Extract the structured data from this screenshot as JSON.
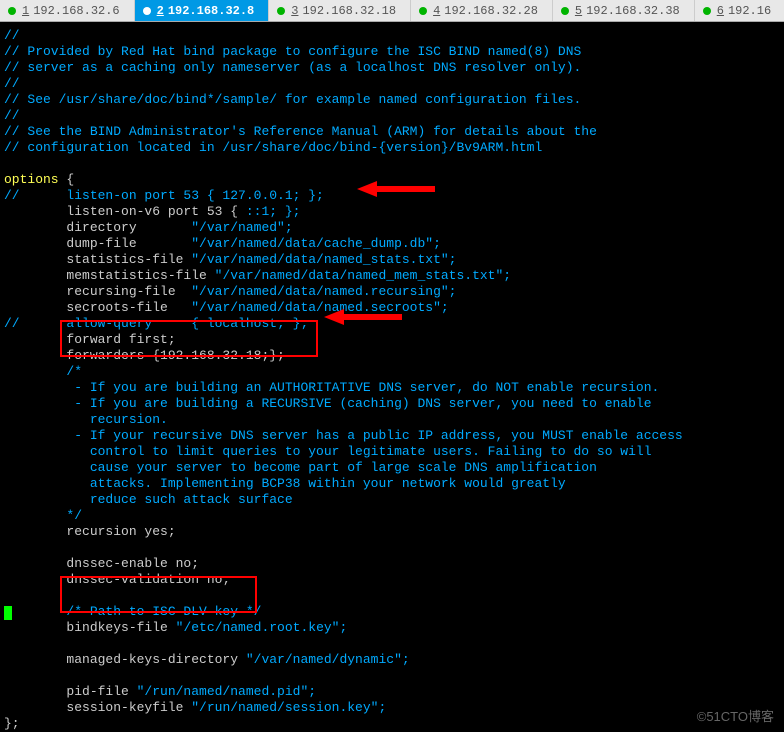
{
  "tabs": [
    {
      "num": "1",
      "ip": "192.168.32.6",
      "active": false
    },
    {
      "num": "2",
      "ip": "192.168.32.8",
      "active": true
    },
    {
      "num": "3",
      "ip": "192.168.32.18",
      "active": false
    },
    {
      "num": "4",
      "ip": "192.168.32.28",
      "active": false
    },
    {
      "num": "5",
      "ip": "192.168.32.38",
      "active": false
    },
    {
      "num": "6",
      "ip": "192.16",
      "active": false
    }
  ],
  "code": {
    "l01": "//",
    "l02": "// Provided by Red Hat bind package to configure the ISC BIND named(8) DNS",
    "l03": "// server as a caching only nameserver (as a localhost DNS resolver only).",
    "l04": "//",
    "l05": "// See /usr/share/doc/bind*/sample/ for example named configuration files.",
    "l06": "//",
    "l07": "// See the BIND Administrator's Reference Manual (ARM) for details about the",
    "l08": "// configuration located in /usr/share/doc/bind-{version}/Bv9ARM.html",
    "l09": "",
    "l10a": "options ",
    "l10b": "{",
    "l11": "//      listen-on port 53 { 127.0.0.1; };",
    "l12a": "        listen-on-v6 port 53 { ",
    "l12b": "::1; };",
    "l13a": "        directory       ",
    "l13b": "\"/var/named\";",
    "l14a": "        dump-file       ",
    "l14b": "\"/var/named/data/cache_dump.db\";",
    "l15a": "        statistics-file ",
    "l15b": "\"/var/named/data/named_stats.txt\";",
    "l16a": "        memstatistics-file ",
    "l16b": "\"/var/named/data/named_mem_stats.txt\";",
    "l17a": "        recursing-file  ",
    "l17b": "\"/var/named/data/named.recursing\";",
    "l18a": "        secroots-file   ",
    "l18b": "\"/var/named/data/named.secroots\";",
    "l19": "//      allow-query     { localhost; };",
    "l20": "        forward first;",
    "l21": "        forwarders {192.168.32.18;};",
    "l22": "        /*",
    "l23": "         - If you are building an AUTHORITATIVE DNS server, do NOT enable recursion.",
    "l24": "         - If you are building a RECURSIVE (caching) DNS server, you need to enable",
    "l25": "           recursion.",
    "l26": "         - If your recursive DNS server has a public IP address, you MUST enable access",
    "l27": "           control to limit queries to your legitimate users. Failing to do so will",
    "l28": "           cause your server to become part of large scale DNS amplification",
    "l29": "           attacks. Implementing BCP38 within your network would greatly",
    "l30": "           reduce such attack surface",
    "l31": "        */",
    "l32": "        recursion yes;",
    "l33": "",
    "l34": "        dnssec-enable no;",
    "l35": "        dnssec-validation no;",
    "l36": "",
    "l37": "        /* Path to ISC DLV key */",
    "l38a": "        bindkeys-file ",
    "l38b": "\"/etc/named.root.key\";",
    "l39": "",
    "l40a": "        managed-keys-directory ",
    "l40b": "\"/var/named/dynamic\";",
    "l41": "",
    "l42a": "        pid-file ",
    "l42b": "\"/run/named/named.pid\";",
    "l43a": "        session-keyfile ",
    "l43b": "\"/run/named/session.key\";",
    "l44": "};"
  },
  "watermark": "©51CTO博客"
}
